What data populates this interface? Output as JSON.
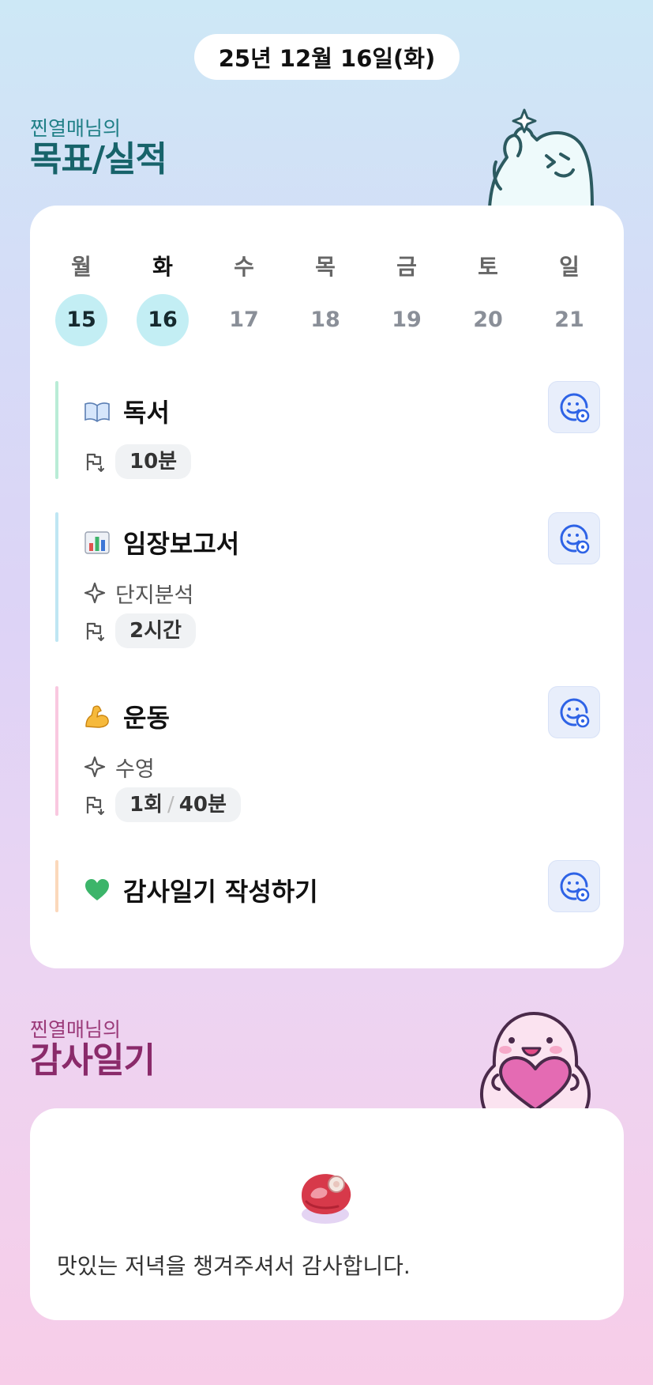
{
  "date_label": "25년 12월 16일(화)",
  "goals_section": {
    "subtitle": "찐열매님의",
    "title": "목표/실적"
  },
  "week": {
    "days": [
      {
        "weekday": "월",
        "date": "15",
        "marked": true,
        "today": false
      },
      {
        "weekday": "화",
        "date": "16",
        "marked": true,
        "today": true
      },
      {
        "weekday": "수",
        "date": "17",
        "marked": false,
        "today": false
      },
      {
        "weekday": "목",
        "date": "18",
        "marked": false,
        "today": false
      },
      {
        "weekday": "금",
        "date": "19",
        "marked": false,
        "today": false
      },
      {
        "weekday": "토",
        "date": "20",
        "marked": false,
        "today": false
      },
      {
        "weekday": "일",
        "date": "21",
        "marked": false,
        "today": false
      }
    ]
  },
  "goals": [
    {
      "icon": "book-icon",
      "title": "독서",
      "detail": "",
      "amount": "10분",
      "amount_extra": "",
      "bar_color": "#b9ecd6"
    },
    {
      "icon": "bar-chart-icon",
      "title": "임장보고서",
      "detail": "단지분석",
      "amount": "2시간",
      "amount_extra": "",
      "bar_color": "#bfe6f3"
    },
    {
      "icon": "flexed-biceps-icon",
      "title": "운동",
      "detail": "수영",
      "amount": "1회",
      "amount_extra": "40분",
      "bar_color": "#f9c8e0"
    },
    {
      "icon": "green-heart-icon",
      "title": "감사일기 작성하기",
      "detail": "",
      "amount": "",
      "amount_extra": "",
      "bar_color": "#fbd8bb"
    }
  ],
  "diary_section": {
    "subtitle": "찐열매님의",
    "title": "감사일기"
  },
  "diary": {
    "icon": "meat-icon",
    "text": "맛있는 저녁을 챙겨주셔서 감사합니다."
  },
  "colors": {
    "accent_teal": "#17636a",
    "accent_plum": "#8a2a6a",
    "day_marked": "#c3eef4",
    "react_button": "#e8eefb",
    "react_icon": "#2e63e6"
  }
}
